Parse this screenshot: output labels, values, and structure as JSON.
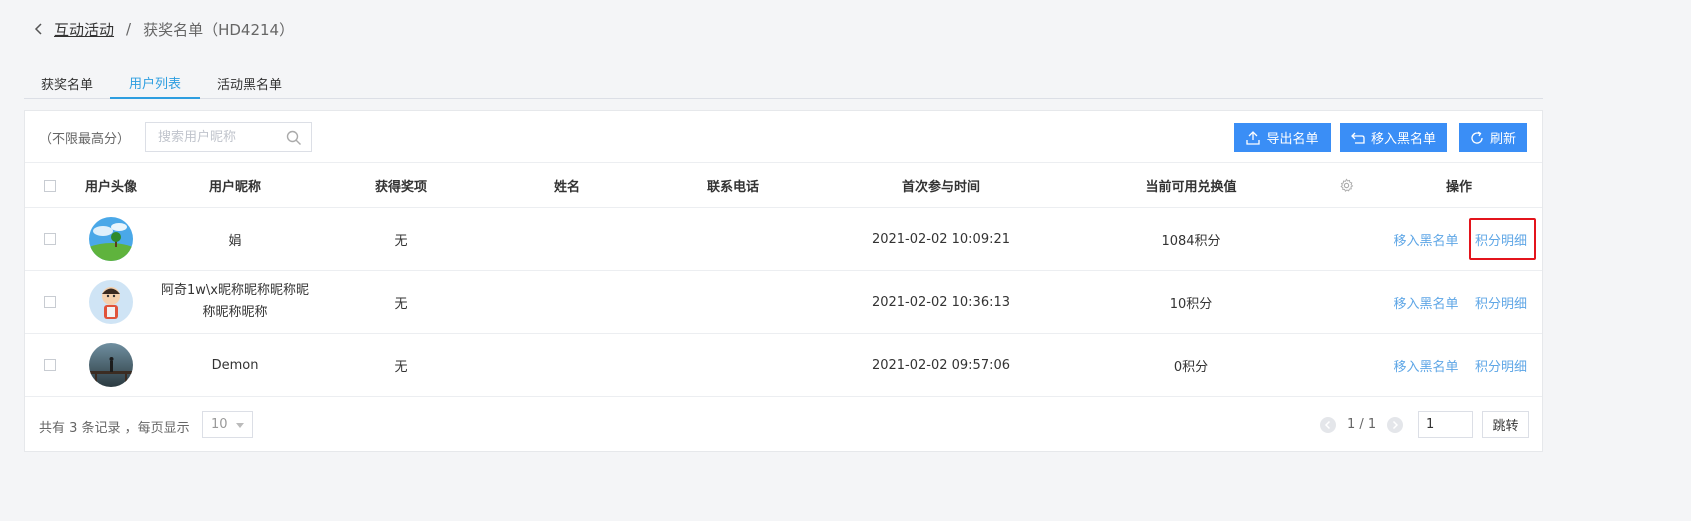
{
  "breadcrumb": {
    "parent": "互动活动",
    "separator": "/",
    "current": "获奖名单（HD4214）"
  },
  "tabs": [
    {
      "label": "获奖名单",
      "active": false
    },
    {
      "label": "用户列表",
      "active": true
    },
    {
      "label": "活动黑名单",
      "active": false
    }
  ],
  "toolbar": {
    "score_label": "（不限最高分）",
    "search_placeholder": "搜索用户昵称",
    "export_label": "导出名单",
    "blacklist_label": "移入黑名单",
    "refresh_label": "刷新"
  },
  "table": {
    "headers": {
      "avatar": "用户头像",
      "nickname": "用户昵称",
      "prize": "获得奖项",
      "name": "姓名",
      "phone": "联系电话",
      "first_time": "首次参与时间",
      "points": "当前可用兑换值",
      "actions": "操作"
    },
    "rows": [
      {
        "nickname": "娟",
        "prize": "无",
        "name": "",
        "phone": "",
        "first_time": "2021-02-02 10:09:21",
        "points": "1084积分",
        "action_blacklist": "移入黑名单",
        "action_points": "积分明细"
      },
      {
        "nickname": "阿奇1w\\x昵称昵称昵称昵称昵称昵称",
        "prize": "无",
        "name": "",
        "phone": "",
        "first_time": "2021-02-02 10:36:13",
        "points": "10积分",
        "action_blacklist": "移入黑名单",
        "action_points": "积分明细"
      },
      {
        "nickname": "Demon",
        "prize": "无",
        "name": "",
        "phone": "",
        "first_time": "2021-02-02 09:57:06",
        "points": "0积分",
        "action_blacklist": "移入黑名单",
        "action_points": "积分明细"
      }
    ]
  },
  "footer": {
    "summary": "共有 3 条记录 ，每页显示",
    "page_size": "10",
    "page_info": "1 / 1",
    "page_input": "1",
    "jump_label": "跳转"
  },
  "colors": {
    "primary": "#3a8ef6",
    "link": "#5ea6e6",
    "highlight": "#e3141c"
  }
}
